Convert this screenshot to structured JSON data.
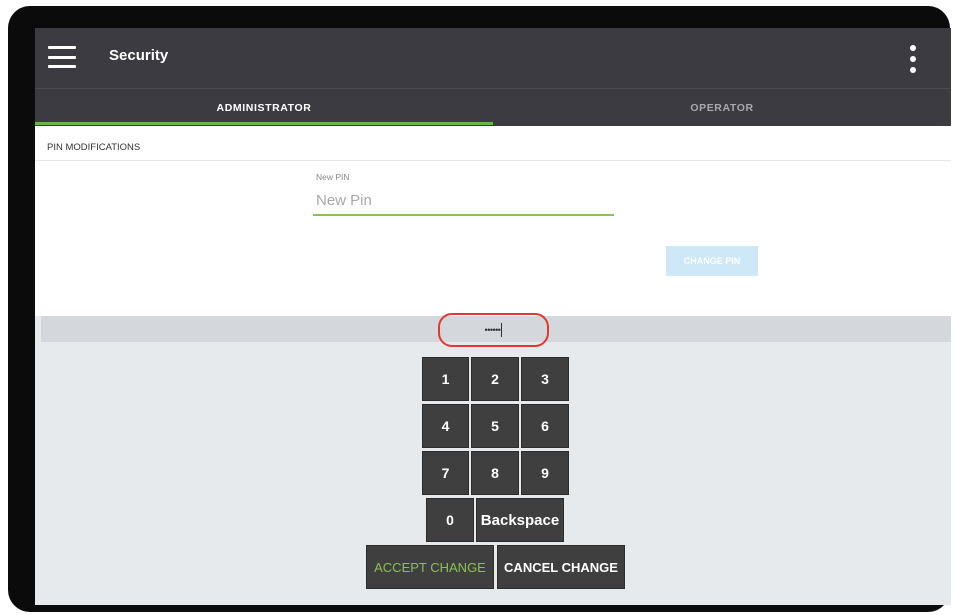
{
  "appbar": {
    "title": "Security",
    "menu_icon": "hamburger-menu-icon",
    "more_icon": "more-vertical-icon"
  },
  "tabs": [
    {
      "label": "ADMINISTRATOR",
      "active": true
    },
    {
      "label": "OPERATOR",
      "active": false
    }
  ],
  "section": {
    "title": "PIN MODIFICATIONS"
  },
  "new_pin": {
    "label": "New PIN",
    "placeholder": "New Pin",
    "value": ""
  },
  "change_pin_button": "CHANGE PIN",
  "pin_entry": {
    "masked_value": "••••••"
  },
  "keypad": {
    "keys": [
      "1",
      "2",
      "3",
      "4",
      "5",
      "6",
      "7",
      "8",
      "9",
      "0"
    ],
    "backspace": "Backspace"
  },
  "actions": {
    "accept": "ACCEPT CHANGE",
    "cancel": "CANCEL CHANGE"
  },
  "colors": {
    "appbar": "#3d3b42",
    "accent_green": "#6db33f",
    "highlight_red": "#e03a2f",
    "key_background": "#3f3f3f",
    "change_pin_disabled": "#cfe8f7"
  }
}
